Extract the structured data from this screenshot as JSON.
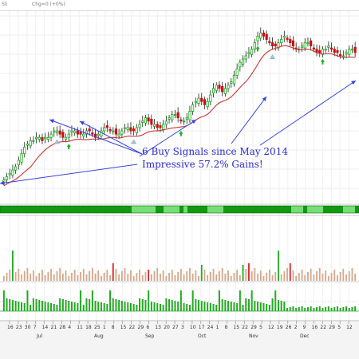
{
  "header": {
    "symbol_fragment": "Sli",
    "change_text": "Chg=0 (+0%)"
  },
  "annotation": {
    "line1": "6 Buy Signals since May 2014",
    "line2": "Impressive 57.2% Gains!"
  },
  "colors": {
    "up": "#11aa11",
    "down": "#cc1111",
    "ma": "#cc3333",
    "arrow": "#3344dd",
    "annotation_text": "#2a2acc",
    "signal_dark": "#119911",
    "signal_light": "#77dd77",
    "volume_bar": "#d4a78a",
    "volume_spike_down": "#dd2222",
    "volume_spike_up": "#22aa22",
    "histogram": "#22aa22"
  },
  "chart_data": {
    "type": "candlestick",
    "description_series": "Price candles with moving average, signal strip, volume bars and volume histogram",
    "x_tick_labels": [
      "16",
      "23",
      "30",
      "7",
      "14",
      "21",
      "28",
      "4",
      "11",
      "18",
      "25",
      "1",
      "8",
      "15",
      "22",
      "29",
      "6",
      "13",
      "20",
      "27",
      "3",
      "10",
      "17",
      "24",
      "1",
      "8",
      "15",
      "22",
      "29",
      "5",
      "12",
      "19",
      "26",
      "2",
      "9",
      "16",
      "22",
      "29",
      "5",
      "12"
    ],
    "month_labels": [
      "Jul",
      "Aug",
      "Sep",
      "Oct",
      "Nov",
      "Dec"
    ],
    "buy_signal_markers": 6,
    "price": {
      "close": [
        34,
        35,
        36,
        37,
        38,
        40,
        42,
        44,
        45,
        46,
        46,
        47,
        47,
        46,
        47,
        47,
        48,
        49,
        49,
        48,
        47,
        47,
        48,
        49,
        49,
        48,
        48,
        48,
        49,
        49,
        48,
        47,
        48,
        49,
        50,
        50,
        49,
        49,
        48,
        48,
        49,
        50,
        50,
        49,
        49,
        50,
        51,
        52,
        53,
        52,
        51,
        51,
        50,
        50,
        51,
        52,
        53,
        54,
        54,
        53,
        52,
        52,
        53,
        55,
        57,
        58,
        59,
        58,
        57,
        58,
        60,
        62,
        63,
        62,
        61,
        62,
        63,
        64,
        66,
        68,
        70,
        71,
        72,
        73,
        74,
        76,
        78,
        79,
        78,
        77,
        76,
        75,
        75,
        76,
        77,
        78,
        77,
        76,
        75,
        74,
        74,
        75,
        76,
        76,
        75,
        74,
        73,
        73,
        74,
        74,
        75,
        74,
        73,
        73,
        72,
        72,
        73,
        74,
        74,
        73
      ]
    }
  }
}
